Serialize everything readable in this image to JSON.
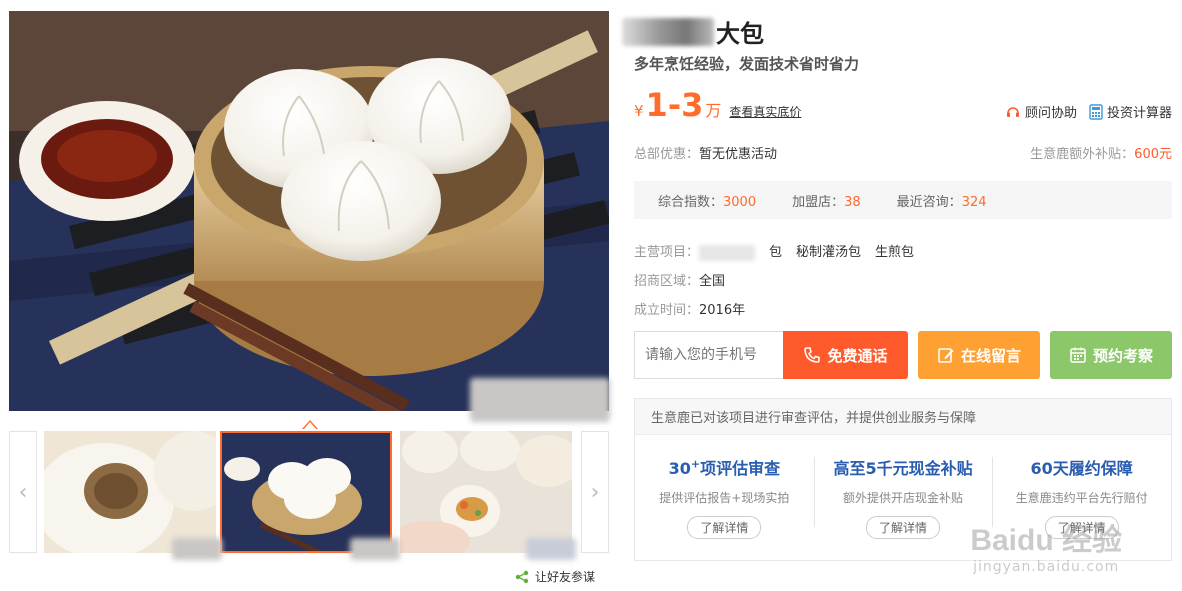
{
  "title": {
    "suffix": "大包"
  },
  "subtitle": "多年烹饪经验，发面技术省时省力",
  "price": {
    "currency": "¥",
    "range": "1-3",
    "unit": "万",
    "link": "查看真实底价"
  },
  "tools": {
    "advisor": "顾问协助",
    "calculator": "投资计算器"
  },
  "promo": {
    "hq_label": "总部优惠：",
    "hq_value": "暂无优惠活动",
    "extra_label": "生意鹿额外补贴：",
    "extra_value": "600元"
  },
  "stats": [
    {
      "label": "综合指数：",
      "value": "3000"
    },
    {
      "label": "加盟店：",
      "value": "38"
    },
    {
      "label": "最近咨询：",
      "value": "324"
    }
  ],
  "meta": {
    "main_label": "主营项目：",
    "main_items": [
      "包",
      "秘制灌汤包",
      "生煎包"
    ],
    "region_label": "招商区域：",
    "region_value": "全国",
    "founded_label": "成立时间：",
    "founded_value": "2016年"
  },
  "form": {
    "phone_placeholder": "请输入您的手机号"
  },
  "buttons": {
    "call": "免费通话",
    "message": "在线留言",
    "visit": "预约考察"
  },
  "assure": {
    "head": "生意鹿已对该项目进行审查评估，并提供创业服务与保障",
    "cols": [
      {
        "title_pre": "30",
        "title_sup": "+",
        "title_post": "项评估审查",
        "desc": "提供评估报告+现场实拍",
        "more": "了解详情"
      },
      {
        "title_pre": "高至5千元现金补贴",
        "title_sup": "",
        "title_post": "",
        "desc": "额外提供开店现金补贴",
        "more": "了解详情"
      },
      {
        "title_pre": "60天履约保障",
        "title_sup": "",
        "title_post": "",
        "desc": "生意鹿违约平台先行赔付",
        "more": "了解详情"
      }
    ]
  },
  "share": "让好友参谋",
  "watermark": {
    "line1": "Baidu 经验",
    "line2": "jingyan.baidu.com"
  },
  "colors": {
    "accent": "#ff6b2b",
    "call": "#ff5a2b",
    "message": "#ffa033",
    "visit": "#8cc76a",
    "assure_title": "#2a5db0"
  }
}
